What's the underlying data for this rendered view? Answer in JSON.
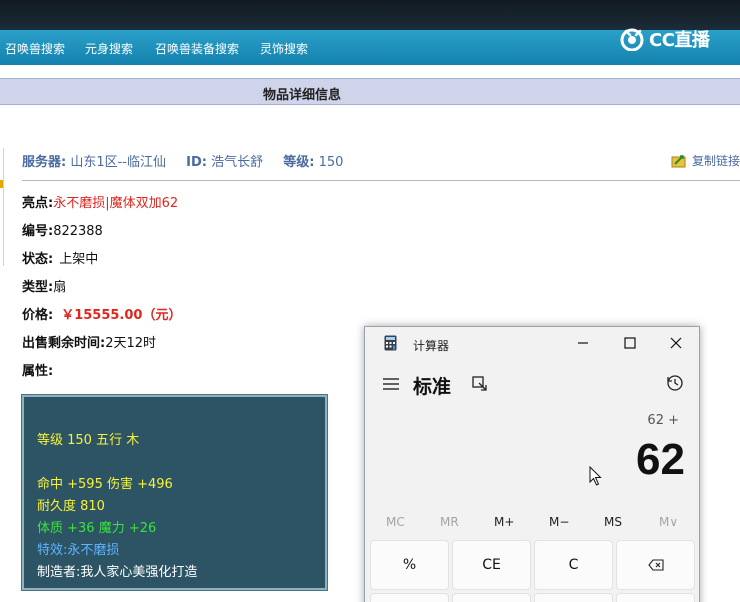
{
  "nav": {
    "items": [
      "召唤兽搜索",
      "元身搜索",
      "召唤兽装备搜索",
      "灵饰搜索"
    ],
    "logo_text": "CC直播"
  },
  "detail": {
    "header_title": "物品详细信息",
    "server_label": "服务器:",
    "server_value": "山东1区--临江仙",
    "id_label": "ID:",
    "id_value": "浩气长舒",
    "level_label": "等级:",
    "level_value": "150",
    "copy_link": "复制链接",
    "highlight_label": "亮点:",
    "highlight_value": "永不磨损|魔体双加62",
    "number_label": "编号:",
    "number_value": "822388",
    "status_label": "状态:",
    "status_value": "上架中",
    "type_label": "类型:",
    "type_value": "扇",
    "price_label": "价格:",
    "price_value": "￥15555.00（元）",
    "time_label": "出售剩余时间:",
    "time_value": "2天12时",
    "attr_label": "属性:"
  },
  "props": {
    "line1": "等级 150 五行 木",
    "line2": "命中 +595 伤害 +496",
    "line3": "耐久度 810",
    "line4": "体质 +36 魔力 +26",
    "line5": "特效:永不磨损",
    "line6": "制造者:我人家心美强化打造"
  },
  "calculator": {
    "title": "计算器",
    "mode": "标准",
    "expression": "62 +",
    "result": "62",
    "memory_buttons": [
      "MC",
      "MR",
      "M+",
      "M−",
      "MS",
      "M∨"
    ],
    "keys": [
      "%",
      "CE",
      "C",
      "⌫"
    ]
  },
  "colors": {
    "nav_bg": "#1a8fbb",
    "header_bg": "#cfd4ea",
    "props_bg": "#2d5465",
    "accent_red": "#e0261f",
    "link_blue": "#4a6aa0"
  }
}
